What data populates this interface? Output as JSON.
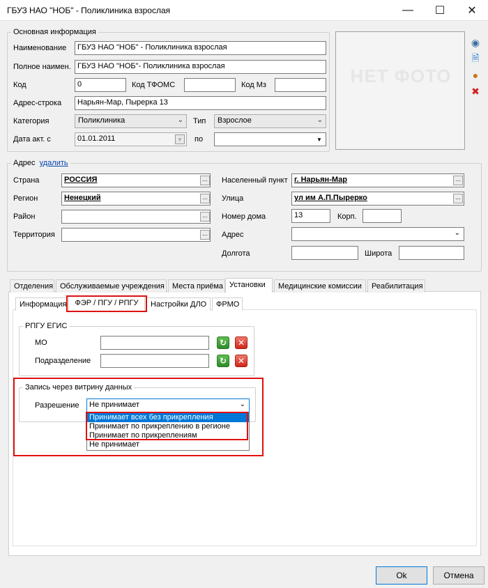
{
  "window": {
    "title": "ГБУЗ НАО \"НОБ\" - Поликлиника взрослая"
  },
  "main": {
    "legend": "Основная информация",
    "name_label": "Наименование",
    "name_value": "ГБУЗ НАО \"НОБ\" - Поликлиника взрослая",
    "fullname_label": "Полное наимен.",
    "fullname_value": "ГБУЗ НАО \"НОБ\"- Поликлиника взрослая",
    "code_label": "Код",
    "code_value": "0",
    "tfoms_label": "Код ТФОМС",
    "tfoms_value": "",
    "mz_label": "Код Мз",
    "mz_value": "",
    "address_line_label": "Адрес-строка",
    "address_line_value": "Нарьян-Мар, Пырерка 13",
    "category_label": "Категория",
    "category_value": "Поликлиника",
    "type_label": "Тип",
    "type_value": "Взрослое",
    "date_label": "Дата акт. с",
    "date_value": "01.01.2011",
    "to_label": "по",
    "to_value": ""
  },
  "photo": {
    "placeholder": "НЕТ ФОТО"
  },
  "address": {
    "legend": "Адрес",
    "delete_link": "удалить",
    "country_label": "Страна",
    "country_value": "РОССИЯ",
    "region_label": "Регион",
    "region_value": "Ненецкий",
    "district_label": "Район",
    "district_value": "",
    "territory_label": "Территория",
    "territory_value": "",
    "settlement_label": "Населенный пункт",
    "settlement_value": "г. Нарьян-Мар",
    "street_label": "Улица",
    "street_value": "ул им А.П.Пырерко",
    "house_label": "Номер дома",
    "house_value": "13",
    "korp_label": "Корп.",
    "korp_value": "",
    "addr_label": "Адрес",
    "addr_value": "",
    "lon_label": "Долгота",
    "lon_value": "",
    "lat_label": "Широта",
    "lat_value": ""
  },
  "tabs": [
    "Отделения",
    "Обслуживаемые учреждения",
    "Места приёма",
    "Установки",
    "Медицинские комиссии",
    "Реабилитация"
  ],
  "subtabs": [
    "Информация",
    "ФЭР / ПГУ / РПГУ",
    "Настройки ДЛО",
    "ФРМО"
  ],
  "rpgu": {
    "legend": "РПГУ ЕГИС",
    "mo_label": "МО",
    "mo_value": "",
    "dept_label": "Подразделение",
    "dept_value": ""
  },
  "showcase": {
    "legend": "Запись через витрину данных",
    "permission_label": "Разрешение",
    "permission_value": "Не принимает",
    "options": [
      "Принимает всех без прикрепления",
      "Принимает по прикреплению в регионе",
      "Принимает по прикреплениям",
      "Не принимает"
    ],
    "highlighted_option": "Принимает всех без прикрепления"
  },
  "buttons": {
    "ok": "Ok",
    "cancel": "Отмена"
  },
  "colors": {
    "highlight_red": "#e01010",
    "selection_blue": "#0078d7"
  }
}
